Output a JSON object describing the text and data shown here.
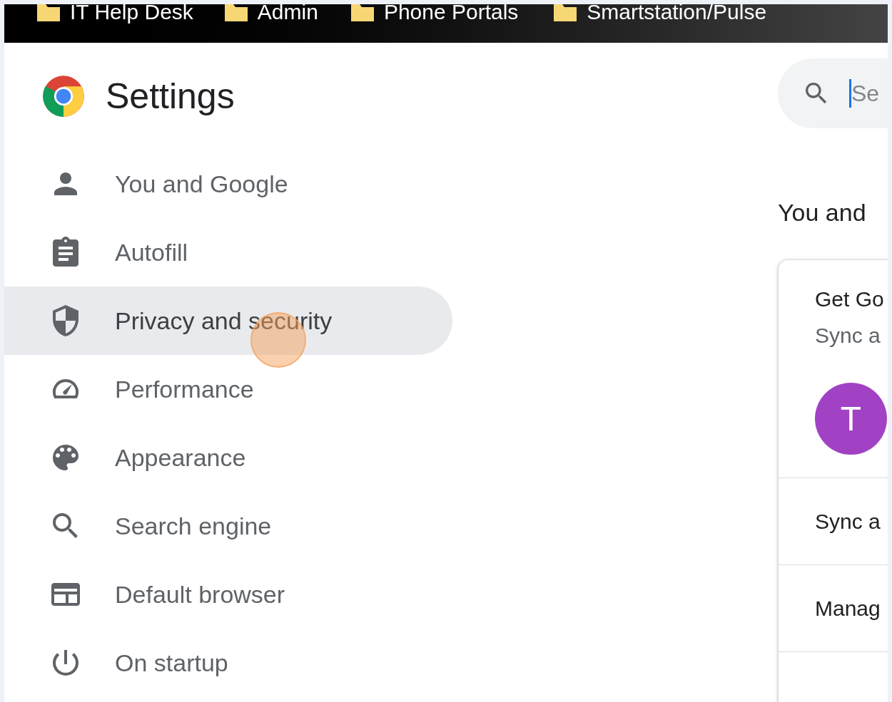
{
  "bookmarks": [
    {
      "label": "IT Help Desk"
    },
    {
      "label": "Admin"
    },
    {
      "label": "Phone Portals"
    },
    {
      "label": "Smartstation/Pulse"
    }
  ],
  "header": {
    "title": "Settings"
  },
  "search": {
    "placeholder": "Se"
  },
  "sidebar": {
    "items": [
      {
        "label": "You and Google",
        "kind": "person",
        "selected": false
      },
      {
        "label": "Autofill",
        "kind": "clipboard",
        "selected": false
      },
      {
        "label": "Privacy and security",
        "kind": "shield",
        "selected": true
      },
      {
        "label": "Performance",
        "kind": "gauge",
        "selected": false
      },
      {
        "label": "Appearance",
        "kind": "palette",
        "selected": false
      },
      {
        "label": "Search engine",
        "kind": "search",
        "selected": false
      },
      {
        "label": "Default browser",
        "kind": "browser",
        "selected": false
      },
      {
        "label": "On startup",
        "kind": "power",
        "selected": false
      }
    ]
  },
  "section": {
    "title": "You and"
  },
  "card": {
    "title": "Get Go",
    "subtitle": "Sync a",
    "avatar": "T",
    "rows": [
      "Sync a",
      "Manag"
    ]
  }
}
